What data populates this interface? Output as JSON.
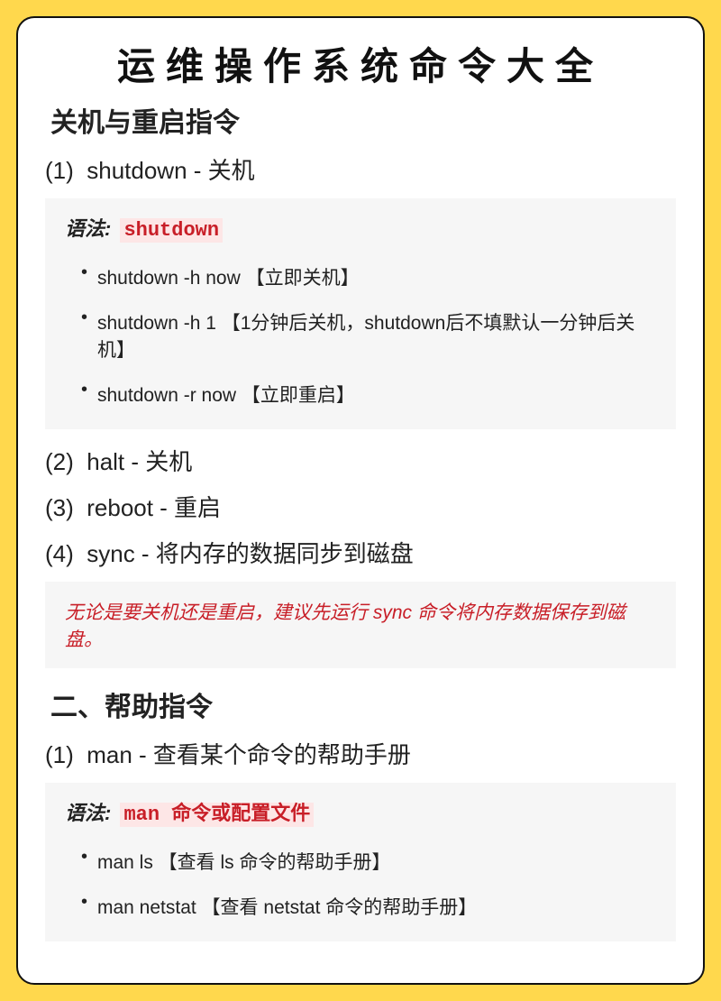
{
  "title": "运维操作系统命令大全",
  "section1": {
    "heading": "关机与重启指令",
    "items": [
      {
        "num": "(1)",
        "text": "shutdown - 关机"
      },
      {
        "num": "(2)",
        "text": "halt - 关机"
      },
      {
        "num": "(3)",
        "text": "reboot - 重启"
      },
      {
        "num": "(4)",
        "text": "sync - 将内存的数据同步到磁盘"
      }
    ],
    "syntax_label": "语法:",
    "syntax_kw": "shutdown",
    "bullets": [
      "shutdown -h now 【立即关机】",
      "shutdown -h 1 【1分钟后关机，shutdown后不填默认一分钟后关机】",
      "shutdown -r now 【立即重启】"
    ],
    "note": "无论是要关机还是重启，建议先运行 sync 命令将内存数据保存到磁盘。"
  },
  "section2": {
    "heading": "二、帮助指令",
    "items": [
      {
        "num": "(1)",
        "text": "man - 查看某个命令的帮助手册"
      }
    ],
    "syntax_label": "语法:",
    "syntax_kw": "man 命令或配置文件",
    "bullets": [
      "man ls 【查看 ls 命令的帮助手册】",
      "man netstat 【查看 netstat 命令的帮助手册】"
    ]
  }
}
